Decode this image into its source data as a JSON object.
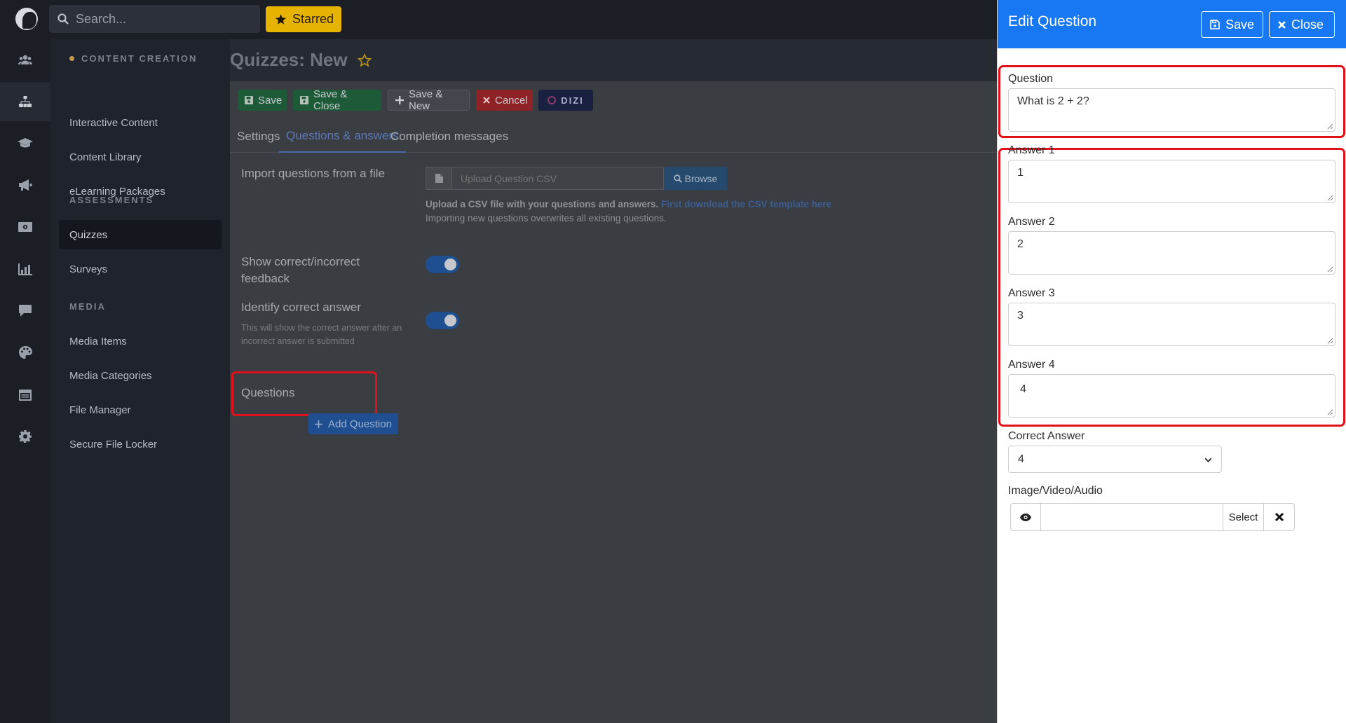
{
  "topbar": {
    "search_placeholder": "Search...",
    "starred_label": "Starred"
  },
  "rail": {
    "icons": [
      "users-icon",
      "sitemap-icon",
      "graduation-cap-icon",
      "megaphone-icon",
      "money-icon",
      "chart-icon",
      "chat-icon",
      "palette-icon",
      "calendar-icon",
      "gear-icon"
    ],
    "active": "sitemap-icon"
  },
  "sidenav": {
    "sections": [
      {
        "title": "CONTENT CREATION",
        "items": [
          "Interactive Content",
          "Content Library",
          "eLearning Packages"
        ]
      },
      {
        "title": "ASSESSMENTS",
        "items": [
          "Quizzes",
          "Surveys"
        ]
      },
      {
        "title": "MEDIA",
        "items": [
          "Media Items",
          "Media Categories",
          "File Manager",
          "Secure File Locker"
        ]
      }
    ],
    "active_item": "Quizzes"
  },
  "main": {
    "title": "Quizzes: New",
    "toolbar": {
      "save": "Save",
      "save_close": "Save & Close",
      "save_new": "Save & New",
      "cancel": "Cancel",
      "dizi": "DIZI"
    },
    "tabs": [
      "Settings",
      "Questions & answers",
      "Completion messages"
    ],
    "active_tab": "Questions & answers",
    "import": {
      "label": "Import questions from a file",
      "placeholder": "Upload Question CSV",
      "browse": "Browse",
      "note_bold": "Upload a CSV file with your questions and answers.",
      "note_link": "First download the CSV template here",
      "note_line2": "Importing new questions overwrites all existing questions."
    },
    "feedback": {
      "label": "Show correct/incorrect feedback",
      "enabled": true
    },
    "identify": {
      "label": "Identify correct answer",
      "help": "This will show the correct answer after an incorrect answer is submitted",
      "enabled": true
    },
    "questions": {
      "label": "Questions",
      "add_button": "Add Question"
    }
  },
  "drawer": {
    "title": "Edit Question",
    "save": "Save",
    "close": "Close",
    "question_label": "Question",
    "question_value": "What is 2 + 2?",
    "answers": [
      {
        "label": "Answer 1",
        "value": "1"
      },
      {
        "label": "Answer 2",
        "value": "2"
      },
      {
        "label": "Answer 3",
        "value": "3"
      },
      {
        "label": "Answer 4",
        "value": "4"
      }
    ],
    "correct_label": "Correct Answer",
    "correct_value": "4",
    "media_label": "Image/Video/Audio",
    "media_select": "Select",
    "media_value": ""
  },
  "colors": {
    "drawer_header": "#1877f2",
    "highlight": "#e0111b",
    "starred": "#e5b300"
  }
}
